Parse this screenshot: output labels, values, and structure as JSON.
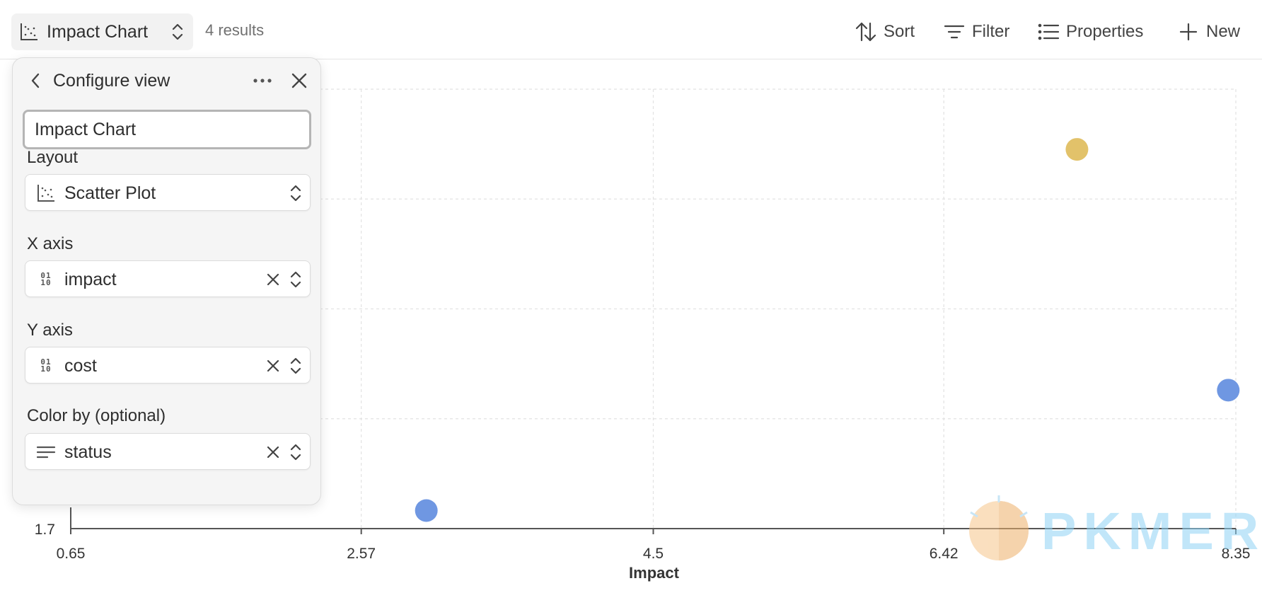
{
  "toolbar": {
    "view_title": "Impact Chart",
    "results": "4 results",
    "sort_label": "Sort",
    "filter_label": "Filter",
    "properties_label": "Properties",
    "new_label": "New"
  },
  "panel": {
    "title": "Configure view",
    "name_value": "Impact Chart",
    "layout_label": "Layout",
    "layout_value": "Scatter Plot",
    "x_axis_label": "X axis",
    "x_axis_value": "impact",
    "y_axis_label": "Y axis",
    "y_axis_value": "cost",
    "color_label": "Color by (optional)",
    "color_value": "status"
  },
  "chart_data": {
    "type": "scatter",
    "xlabel": "Impact",
    "ylabel": "",
    "xlim": [
      0.65,
      8.35
    ],
    "xticks": [
      "0.65",
      "2.57",
      "4.5",
      "6.42",
      "8.35"
    ],
    "yticks_visible": [
      "1.7"
    ],
    "grid": true,
    "points": [
      {
        "x": 7.3,
        "y": 8.0,
        "color": "#e2c26a"
      },
      {
        "x": 8.3,
        "y": 4.0,
        "color": "#6f97e2"
      },
      {
        "x": 3.0,
        "y": 2.0,
        "color": "#6f97e2"
      }
    ]
  },
  "watermark": {
    "text": "PKMER"
  },
  "colors": {
    "accent_yellow": "#e2c26a",
    "accent_blue": "#6f97e2",
    "selection": "#e0d6ff"
  }
}
